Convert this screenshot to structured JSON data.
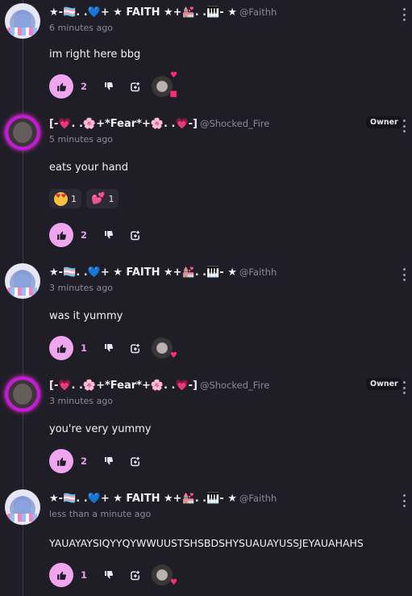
{
  "comments": [
    {
      "author": "★-🏳️‍⚧️. .💙+ ★ FAITH ★+💒. .🎹- ★",
      "handle": "@Faithh",
      "time": "6 minutes ago",
      "text": "im right here bbg",
      "likes": "2",
      "owner": ""
    },
    {
      "author": "[-💗. .🌸+*Fear*+🌸. .💗-]",
      "handle": "@Shocked_Fire",
      "time": "5 minutes ago",
      "text": "eats your hand",
      "likes": "2",
      "owner": "Owner",
      "reactions": [
        {
          "emoji": "heart-eyes",
          "count": "1"
        },
        {
          "emoji": "two-hearts",
          "count": "1"
        }
      ]
    },
    {
      "author": "★-🏳️‍⚧️. .💙+ ★ FAITH ★+💒. .🎹- ★",
      "handle": "@Faithh",
      "time": "3 minutes ago",
      "text": "was it yummy",
      "likes": "1",
      "owner": ""
    },
    {
      "author": "[-💗. .🌸+*Fear*+🌸. .💗-]",
      "handle": "@Shocked_Fire",
      "time": "3 minutes ago",
      "text": "you're very yummy",
      "likes": "2",
      "owner": "Owner"
    },
    {
      "author": "★-🏳️‍⚧️. .💙+ ★ FAITH ★+💒. .🎹- ★",
      "handle": "@Faithh",
      "time": "less than a minute ago",
      "text": "YAUAYAYSIQYYQYWWUUSTSHSBDSHYSUAUAYUSSJEYAUAHAHS",
      "likes": "1",
      "owner": ""
    }
  ],
  "icons": {
    "like": "thumbs-up-icon",
    "dislike": "thumbs-down-icon",
    "reply": "reply-add-icon",
    "more": "more-vertical-icon"
  },
  "colors": {
    "background": "#1f1e27",
    "like_button": "#f0a6ef",
    "like_count": "#e6a0f0",
    "muted_text": "#8c8a98"
  }
}
